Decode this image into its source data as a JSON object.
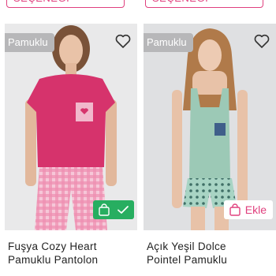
{
  "products": [
    {
      "option_label": "SEÇENEĞİ",
      "badge": "Pamuklu",
      "title_line1": "Fuşya Cozy Heart",
      "title_line2": "Pamuklu Pantolon",
      "cart_state": "added",
      "colors": {
        "top": "#d6336c",
        "pocket": "#f1b8cc",
        "pants": "#f07fa8"
      }
    },
    {
      "option_label": "SEÇENEĞİ",
      "badge": "Pamuklu",
      "title_line1": "Açık Yeşil Dolce",
      "title_line2": "Pointel Pamuklu",
      "cart_label": "Ekle",
      "cart_state": "add",
      "colors": {
        "top": "#9cc9b6",
        "shorts": "#a8d4c4"
      }
    }
  ],
  "colors": {
    "accent": "#e0407e",
    "success": "#27ae60",
    "badge_bg": "#b7b7b9"
  }
}
